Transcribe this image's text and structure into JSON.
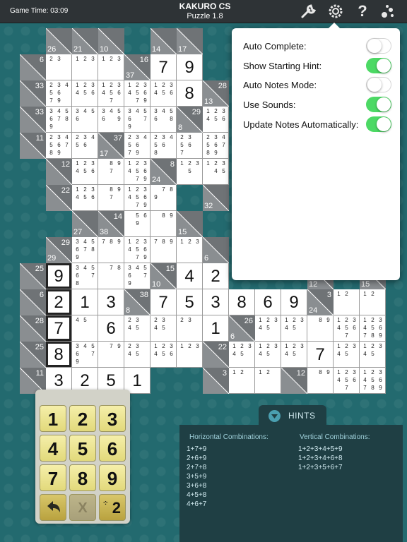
{
  "header": {
    "game_time": "Game Time: 03:09",
    "app_title": "KAKURO CS",
    "puzzle_title": "Puzzle 1.8",
    "icons": [
      "wrench-icon",
      "gear-icon",
      "help-icon",
      "bubbles-icon"
    ]
  },
  "settings": [
    {
      "label": "Auto Complete:",
      "on": false
    },
    {
      "label": "Show Starting Hint:",
      "on": true
    },
    {
      "label": "Auto Notes Mode:",
      "on": false
    },
    {
      "label": "Use Sounds:",
      "on": true
    },
    {
      "label": "Update Notes Automatically:",
      "on": true
    }
  ],
  "colors": {
    "toggle_on": "#4cd964",
    "clue_bg": "#8a8e91",
    "clue_dark": "#6f7376",
    "key_face": "#ecdf8f"
  },
  "keypad": {
    "keys": [
      "1",
      "2",
      "3",
      "4",
      "5",
      "6",
      "7",
      "8",
      "9"
    ],
    "undo_icon": "undo-arrow-icon",
    "clear_label": "X",
    "notes_label": "2"
  },
  "hints": {
    "tab_label": "HINTS",
    "horizontal_title": "Horizontal Combinations:",
    "vertical_title": "Vertical Combinations:",
    "horizontal": [
      "1+7+9",
      "2+6+9",
      "2+7+8",
      "3+5+9",
      "3+6+8",
      "4+5+8",
      "4+6+7"
    ],
    "vertical": [
      "1+2+3+4+5+9",
      "1+2+3+4+6+8",
      "1+2+3+5+6+7"
    ]
  },
  "grid": {
    "rows": [
      [
        "X",
        "D26",
        "D21",
        "D10",
        "X",
        "D14",
        "D17",
        "X",
        "X",
        "X",
        "X",
        "X",
        "X",
        "X"
      ],
      [
        "A6",
        "N23",
        "N123",
        "N123",
        "C37_16",
        "V7",
        "V9",
        "X",
        "X",
        "X",
        "X",
        "X",
        "X",
        "X"
      ],
      [
        "A33",
        "N23456 79",
        "N123456",
        "N123456 7",
        "N123456 79",
        "N123456",
        "V8",
        "C13_28",
        "X",
        "X",
        "X",
        "X",
        "X",
        "X"
      ],
      [
        "A33",
        "N3456789",
        "N3456",
        "N3456 9",
        "N3456 79",
        "N3456 8",
        "C8_29",
        "N123456",
        "X",
        "X",
        "X",
        "X",
        "X",
        "X"
      ],
      [
        "A11",
        "N23456789",
        "N23456",
        "C17_37",
        "N23456 79",
        "N23456 8",
        "N23 56 7",
        "N23456789",
        "X",
        "X",
        "X",
        "X",
        "X",
        "X"
      ],
      [
        "X",
        "A12",
        "N123456",
        "N 89 7",
        "N123456 79",
        "C24_8",
        "N123 5",
        "N123 45",
        "X",
        "X",
        "X",
        "X",
        "X",
        "X"
      ],
      [
        "X",
        "A22",
        "N123456",
        "N 89 7",
        "N123456 79",
        "N 789",
        "X",
        "D32",
        "X",
        "X",
        "X",
        "X",
        "X",
        "X"
      ],
      [
        "X",
        "X",
        "D27",
        "C38_14",
        "N 56 9",
        "N 89",
        "D15",
        "X",
        "X",
        "X",
        "X",
        "X",
        "X",
        "X"
      ],
      [
        "X",
        "C29_29",
        "N3456789",
        "N789",
        "N123456 79",
        "N789",
        "N123",
        "D6",
        "X",
        "X",
        "X",
        "X",
        "X",
        "X"
      ],
      [
        "A25",
        "S9",
        "N3456 78",
        "N 78",
        "N3456 79",
        "C10_15",
        "V4",
        "V2",
        "X",
        "X",
        "X",
        "D12",
        "X",
        "D15"
      ],
      [
        "A6",
        "S2",
        "V1",
        "V3",
        "C8_38",
        "V7",
        "V5",
        "V3",
        "V8",
        "V6",
        "V9",
        "C24_3",
        "N12",
        "N12"
      ],
      [
        "A28",
        "S7",
        "N45",
        "V6",
        "N23 45",
        "N23 45",
        "N23",
        "V1",
        "C6_26",
        "N12345",
        "N12345",
        "N 89",
        "N123456 7",
        "N123456789"
      ],
      [
        "A25",
        "S8",
        "N3456 79",
        "N 79",
        "N23 45",
        "N123456",
        "N123",
        "A22",
        "N12345",
        "N12345",
        "N12345",
        "V7",
        "N12345",
        "N12345"
      ],
      [
        "A11",
        "V3",
        "V2",
        "V5",
        "V1",
        "X",
        "X",
        "A3",
        "N12",
        "N12",
        "A12",
        "N 89",
        "N123456 7",
        "N123456789"
      ]
    ]
  }
}
